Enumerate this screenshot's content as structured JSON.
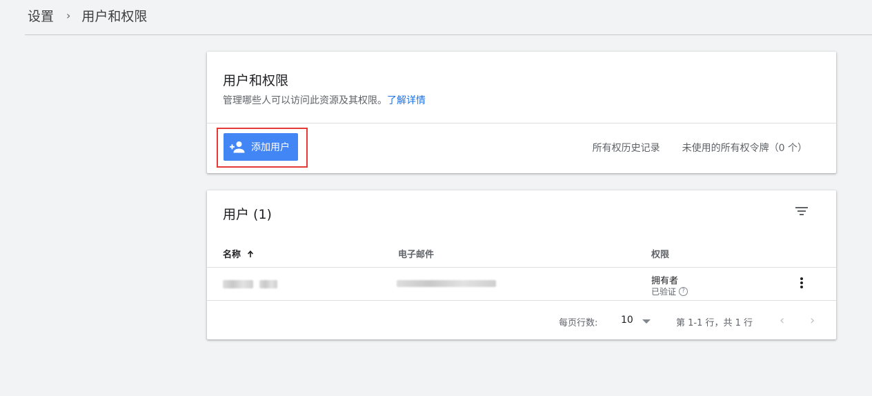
{
  "breadcrumb": {
    "root": "设置",
    "separator": "›",
    "current": "用户和权限"
  },
  "access_card": {
    "title": "用户和权限",
    "description": "管理哪些人可以访问此资源及其权限。",
    "learn_more": "了解详情",
    "add_user_button": "添加用户",
    "ownership_history": "所有权历史记录",
    "unused_tokens": "未使用的所有权令牌（0 个）",
    "accent_color": "#4285f4",
    "link_color": "#1a73e8"
  },
  "users_card": {
    "title": "用户 (1)",
    "columns": {
      "name": "名称",
      "email": "电子邮件",
      "permission": "权限"
    },
    "sort_icon": "arrow-up-icon",
    "rows": [
      {
        "permission_role": "拥有者",
        "permission_status": "已验证",
        "status_icon": "help-circle-icon"
      }
    ],
    "pagination": {
      "rows_per_page_label": "每页行数:",
      "rows_per_page_value": "10",
      "range_text": "第 1-1 行，共 1 行"
    }
  }
}
